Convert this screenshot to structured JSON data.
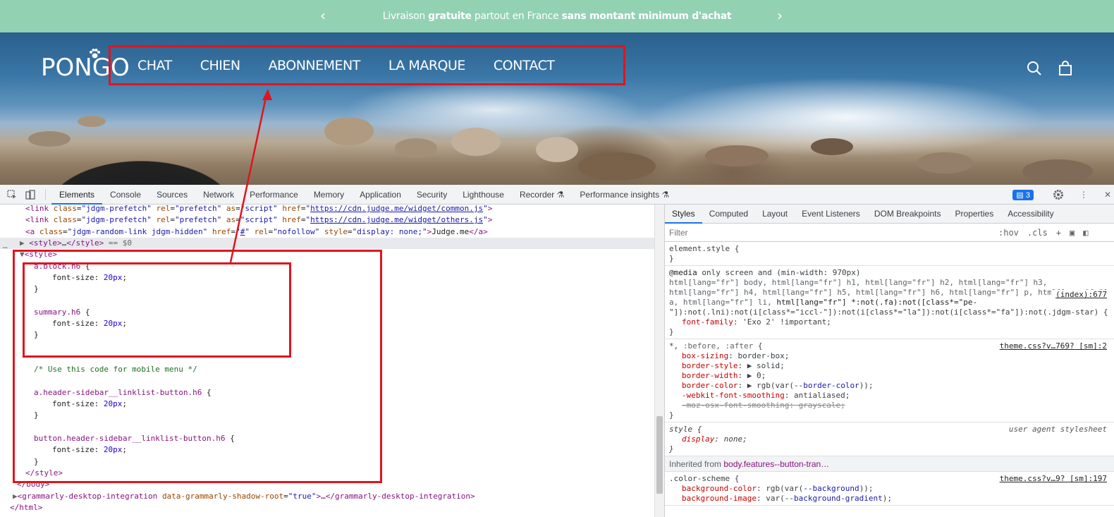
{
  "announcement": {
    "part1": "Livraison ",
    "bold1": "gratuite",
    "part2": " partout en France ",
    "bold2": "sans montant minimum d'achat"
  },
  "header": {
    "logo": "PONGO",
    "nav": [
      "CHAT",
      "CHIEN",
      "ABONNEMENT",
      "LA MARQUE",
      "CONTACT"
    ]
  },
  "devtools": {
    "tabs": [
      "Elements",
      "Console",
      "Sources",
      "Network",
      "Performance",
      "Memory",
      "Application",
      "Security",
      "Lighthouse",
      "Recorder",
      "Performance insights"
    ],
    "active_tab": "Elements",
    "issues_count": "3",
    "dom_lines": [
      {
        "indent": 36,
        "html": "<span class='tag'>&lt;link</span> <span class='att'>class</span>=<span class='val'>\"jdgm-prefetch\"</span> <span class='att'>rel</span>=<span class='val'>\"prefetch\"</span> <span class='att'>as</span>=<span class='val'>\"script\"</span> <span class='att'>href</span>=<span class='val'>\"</span><span class='lnk'>https://cdn.judge.me/widget/common.js</span><span class='val'>\"</span><span class='tag'>&gt;</span>"
      },
      {
        "indent": 36,
        "html": "<span class='tag'>&lt;link</span> <span class='att'>class</span>=<span class='val'>\"jdgm-prefetch\"</span> <span class='att'>rel</span>=<span class='val'>\"prefetch\"</span> <span class='att'>as</span>=<span class='val'>\"script\"</span> <span class='att'>href</span>=<span class='val'>\"</span><span class='lnk'>https://cdn.judge.me/widget/others.js</span><span class='val'>\"</span><span class='tag'>&gt;</span>"
      },
      {
        "indent": 36,
        "html": "<span class='tag'>&lt;a</span> <span class='att'>class</span>=<span class='val'>\"jdgm-random-link jdgm-hidden\"</span> <span class='att'>href</span>=<span class='val'>\"</span><span class='lnk'>#</span><span class='val'>\"</span> <span class='att'>rel</span>=<span class='val'>\"nofollow\"</span> <span class='att'>style</span>=<span class='val'>\"display: none;\"</span><span class='tag'>&gt;</span>Judge.me<span class='tag'>&lt;/a&gt;</span>"
      },
      {
        "indent": 28,
        "sel": true,
        "html": "<span style='color:#666'>▶</span> <span class='tag'>&lt;style&gt;</span>…<span class='tag'>&lt;/style&gt;</span> <span style='color:#666'>== $0</span>"
      },
      {
        "indent": 28,
        "html": "<span style='color:#666'>▼</span><span class='tag'>&lt;style&gt;</span>"
      },
      {
        "indent": 48,
        "html": "<span class='sel-c'>a.block.h6</span> {"
      },
      {
        "indent": 74,
        "html": "font-size: <span class='num'>20px</span>;"
      },
      {
        "indent": 48,
        "html": "}"
      },
      {
        "indent": 48,
        "html": ""
      },
      {
        "indent": 48,
        "html": "<span class='sel-c'>summary.h6</span> {"
      },
      {
        "indent": 74,
        "html": "font-size: <span class='num'>20px</span>;"
      },
      {
        "indent": 48,
        "html": "}"
      },
      {
        "indent": 48,
        "html": ""
      },
      {
        "indent": 48,
        "html": ""
      },
      {
        "indent": 48,
        "html": "<span class='cmt'>/* Use this code for mobile menu */</span>"
      },
      {
        "indent": 48,
        "html": ""
      },
      {
        "indent": 48,
        "html": "<span class='sel-c'>a.header-sidebar__linklist-button.h6</span> {"
      },
      {
        "indent": 74,
        "html": "font-size: <span class='num'>20px</span>;"
      },
      {
        "indent": 48,
        "html": "}"
      },
      {
        "indent": 48,
        "html": ""
      },
      {
        "indent": 48,
        "html": "<span class='sel-c'>button.header-sidebar__linklist-button.h6</span> {"
      },
      {
        "indent": 74,
        "html": "font-size: <span class='num'>20px</span>;"
      },
      {
        "indent": 48,
        "html": "}"
      },
      {
        "indent": 36,
        "html": "<span class='tag'>&lt;/style&gt;</span>"
      },
      {
        "indent": 24,
        "html": "<span class='tag'>&lt;/body&gt;</span>"
      },
      {
        "indent": 18,
        "html": "<span style='color:#666'>▶</span><span class='tag'>&lt;grammarly-desktop-integration</span> <span class='att'>data-grammarly-shadow-root</span>=<span class='val'>\"true\"</span><span class='tag'>&gt;</span>…<span class='tag'>&lt;/grammarly-desktop-integration&gt;</span>"
      },
      {
        "indent": 14,
        "html": "<span class='tag'>&lt;/html&gt;</span>"
      }
    ]
  },
  "styles_panel": {
    "tabs": [
      "Styles",
      "Computed",
      "Layout",
      "Event Listeners",
      "DOM Breakpoints",
      "Properties",
      "Accessibility"
    ],
    "active_tab": "Styles",
    "filter_placeholder": "Filter",
    "hov": ":hov",
    "cls": ".cls",
    "inherited_label": "Inherited from ",
    "inherited_from": "body.features--button-tran…"
  },
  "colors": {
    "announcement_bg": "#93d1b3",
    "highlight": "#e0141e",
    "devtools_accent": "#1a73e8"
  }
}
